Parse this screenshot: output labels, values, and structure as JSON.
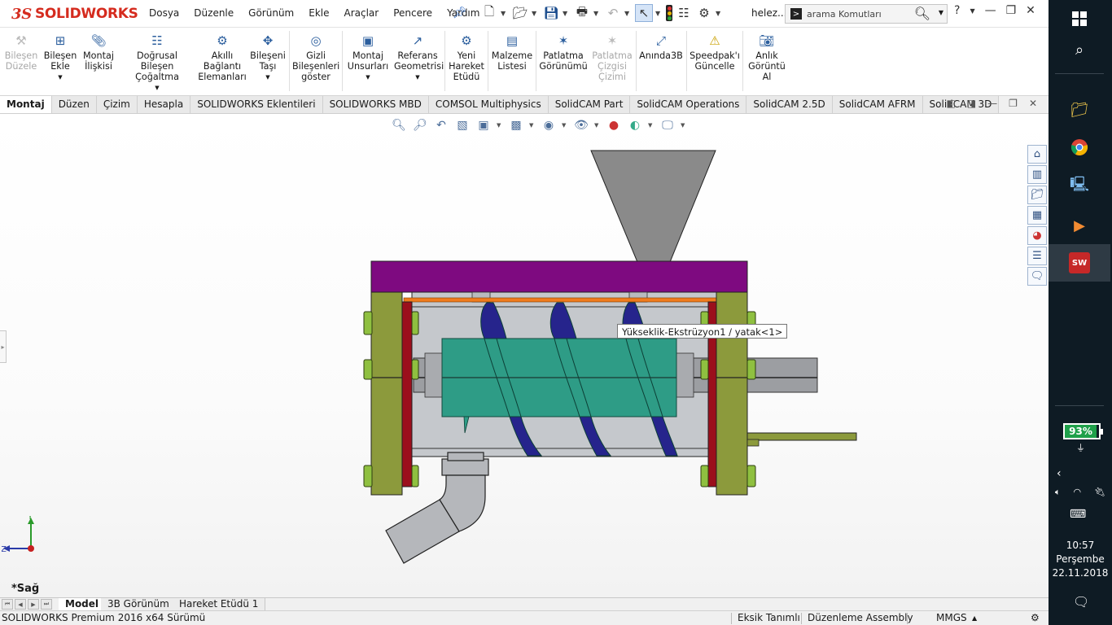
{
  "titlebar": {
    "logo_ds": "3S",
    "logo_text": "SOLIDWORKS",
    "menu": [
      "Dosya",
      "Düzenle",
      "Görünüm",
      "Ekle",
      "Araçlar",
      "Pencere",
      "Yardım"
    ],
    "user": "helez...",
    "search_placeholder": "arama Komutları",
    "help": "?"
  },
  "ribbon": {
    "items": [
      {
        "label1": "Bileşen",
        "label2": "Düzele",
        "icon": "wrench-icon",
        "disabled": true
      },
      {
        "label1": "Bileşen",
        "label2": "Ekle",
        "icon": "add-component-icon"
      },
      {
        "label1": "Montaj",
        "label2": "İlişkisi",
        "icon": "paperclip-icon"
      },
      {
        "label1": "Doğrusal Bileşen",
        "label2": "Çoğaltma",
        "icon": "linear-pattern-icon"
      },
      {
        "label1": "Akıllı",
        "label2": "Bağlantı",
        "label3": "Elemanları",
        "icon": "smart-fastener-icon"
      },
      {
        "label1": "Bileşeni",
        "label2": "Taşı",
        "icon": "move-component-icon"
      },
      {
        "label1": "Gizli",
        "label2": "Bileşenleri",
        "label3": "göster",
        "icon": "show-hidden-icon"
      },
      {
        "label1": "Montaj",
        "label2": "Unsurları",
        "icon": "assembly-features-icon"
      },
      {
        "label1": "Referans",
        "label2": "Geometrisi",
        "icon": "reference-geometry-icon"
      },
      {
        "label1": "Yeni",
        "label2": "Hareket",
        "label3": "Etüdü",
        "icon": "motion-study-icon"
      },
      {
        "label1": "Malzeme",
        "label2": "Listesi",
        "icon": "bom-icon"
      },
      {
        "label1": "Patlatma",
        "label2": "Görünümü",
        "icon": "exploded-view-icon"
      },
      {
        "label1": "Patlatma",
        "label2": "Çizgisi",
        "label3": "Çizimi",
        "icon": "explode-line-icon",
        "disabled": true
      },
      {
        "label1": "Anında3B",
        "icon": "instant3d-icon"
      },
      {
        "label1": "Speedpak'ı",
        "label2": "Güncelle",
        "icon": "speedpak-icon"
      },
      {
        "label1": "Anlık",
        "label2": "Görüntü",
        "label3": "Al",
        "icon": "camera-icon"
      }
    ]
  },
  "tabs": [
    "Montaj",
    "Düzen",
    "Çizim",
    "Hesapla",
    "SOLIDWORKS Eklentileri",
    "SOLIDWORKS MBD",
    "COMSOL Multiphysics",
    "SolidCAM Part",
    "SolidCAM Operations",
    "SolidCAM 2.5D",
    "SolidCAM AFRM",
    "SolidCAM 3D"
  ],
  "viewport": {
    "tooltip": "Yükseklik-Ekstrüzyon1 / yatak<1>",
    "view_name": "*Sağ",
    "triad_y": "Y",
    "triad_z": "Z"
  },
  "bottom_tabs": [
    "Model",
    "3B Görünüm",
    "Hareket Etüdü 1"
  ],
  "status": {
    "product": "SOLIDWORKS Premium 2016 x64 Sürümü",
    "def": "Eksik Tanımlı",
    "mode": "Düzenleme Assembly",
    "units": "MMGS"
  },
  "taskbar": {
    "battery": "93%",
    "time": "10:57",
    "day": "Perşembe",
    "date": "22.11.2018"
  },
  "colors": {
    "brand": "#d52b1e",
    "purple_plate": "#7e0a80",
    "flange": "#8c9a3c",
    "screw_core": "#2e9c86",
    "screw_flight": "#26248c",
    "red_seal": "#9b0f1c",
    "orange_bar": "#f07b1d"
  }
}
